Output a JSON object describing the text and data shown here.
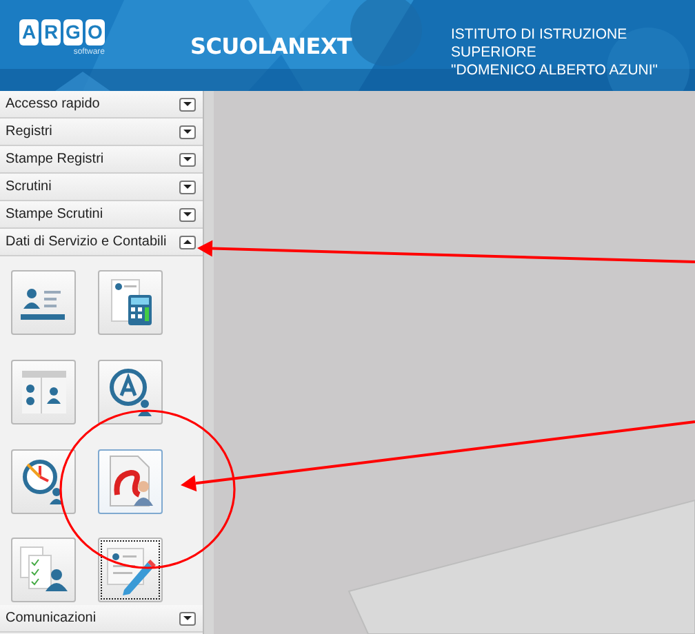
{
  "header": {
    "logo_letters": [
      "A",
      "R",
      "G",
      "O"
    ],
    "logo_caption": "software",
    "product": "SCUOLANEXT",
    "institute": [
      "ISTITUTO DI ISTRUZIONE SUPERIORE",
      "\"DOMENICO ALBERTO AZUNI\""
    ]
  },
  "sidebar": {
    "sections": [
      {
        "label": "Accesso rapido",
        "expanded": false
      },
      {
        "label": "Registri",
        "expanded": false
      },
      {
        "label": "Stampe Registri",
        "expanded": false
      },
      {
        "label": "Scrutini",
        "expanded": false
      },
      {
        "label": "Stampe Scrutini",
        "expanded": false
      },
      {
        "label": "Dati di Servizio e Contabili",
        "expanded": true,
        "tiles": [
          {
            "kind": "card",
            "hovered": false,
            "focused": false
          },
          {
            "kind": "calculator",
            "hovered": false,
            "focused": false
          },
          {
            "kind": "panel",
            "hovered": false,
            "focused": false
          },
          {
            "kind": "letter",
            "hovered": false,
            "focused": false
          },
          {
            "kind": "clock",
            "hovered": false,
            "focused": false
          },
          {
            "kind": "document",
            "hovered": true,
            "focused": false
          },
          {
            "kind": "checklist",
            "hovered": false,
            "focused": false
          },
          {
            "kind": "edit",
            "hovered": false,
            "focused": true
          }
        ]
      },
      {
        "label": "Comunicazioni",
        "expanded": false
      }
    ]
  },
  "annotations": [
    {
      "kind": "arrow"
    },
    {
      "kind": "arrow"
    },
    {
      "kind": "circle"
    }
  ]
}
